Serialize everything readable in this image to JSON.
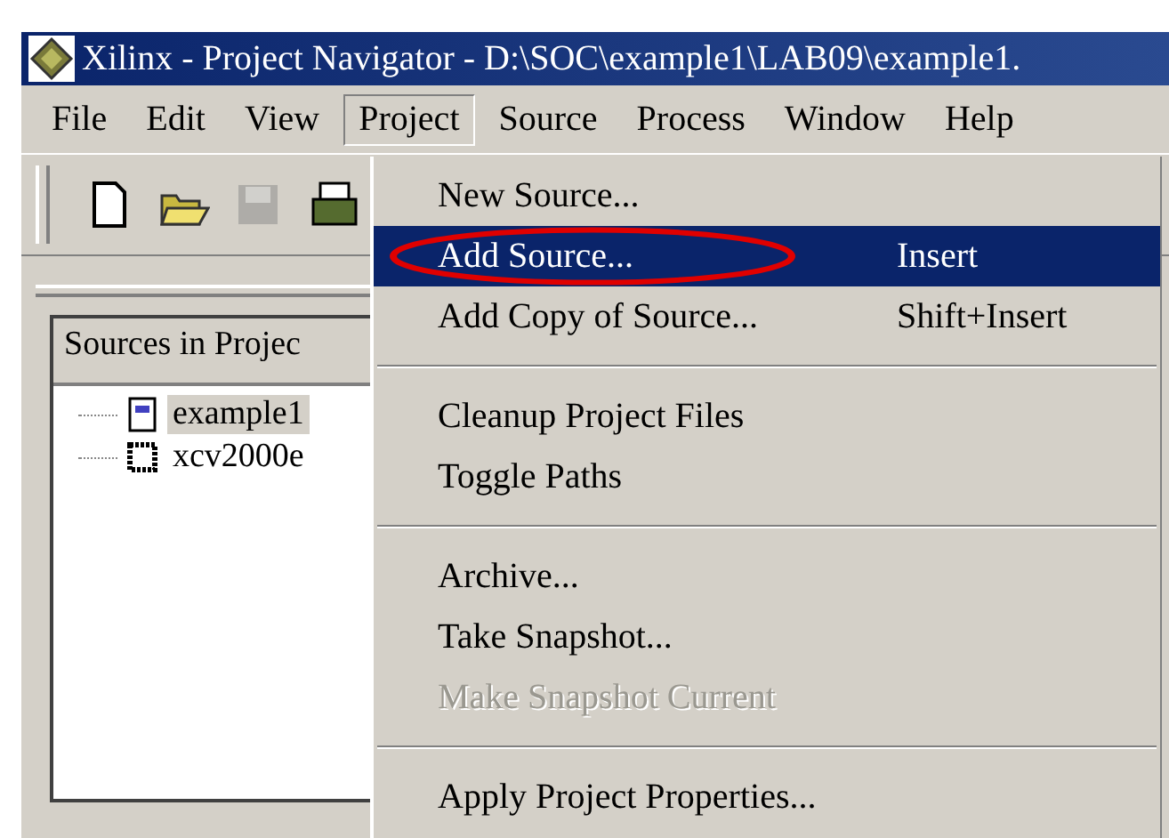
{
  "window": {
    "title": "Xilinx - Project Navigator - D:\\SOC\\example1\\LAB09\\example1."
  },
  "menu_bar": [
    {
      "label": "File",
      "selected": false
    },
    {
      "label": "Edit",
      "selected": false
    },
    {
      "label": "View",
      "selected": false
    },
    {
      "label": "Project",
      "selected": true
    },
    {
      "label": "Source",
      "selected": false
    },
    {
      "label": "Process",
      "selected": false
    },
    {
      "label": "Window",
      "selected": false
    },
    {
      "label": "Help",
      "selected": false
    }
  ],
  "toolbar": [
    {
      "kind": "new",
      "disabled": false
    },
    {
      "kind": "open",
      "disabled": false
    },
    {
      "kind": "save",
      "disabled": true
    },
    {
      "kind": "print",
      "disabled": false
    }
  ],
  "sources_panel": {
    "header": "Sources in Projec",
    "items": [
      {
        "label": "example1",
        "kind": "project",
        "selected": true
      },
      {
        "label": "xcv2000e",
        "kind": "chip",
        "selected": false
      }
    ]
  },
  "project_menu": [
    {
      "kind": "item",
      "label": "New Source...",
      "selected": false,
      "disabled": false,
      "circled": false
    },
    {
      "kind": "item",
      "label": "Add Source...",
      "shortcut": "Insert",
      "selected": true,
      "disabled": false,
      "circled": true
    },
    {
      "kind": "item",
      "label": "Add Copy of Source...",
      "shortcut": "Shift+Insert",
      "selected": false,
      "disabled": false,
      "circled": false
    },
    {
      "kind": "separator"
    },
    {
      "kind": "item",
      "label": "Cleanup Project Files",
      "selected": false,
      "disabled": false,
      "circled": false
    },
    {
      "kind": "item",
      "label": "Toggle Paths",
      "selected": false,
      "disabled": false,
      "circled": false
    },
    {
      "kind": "separator"
    },
    {
      "kind": "item",
      "label": "Archive...",
      "selected": false,
      "disabled": false,
      "circled": false
    },
    {
      "kind": "item",
      "label": "Take Snapshot...",
      "selected": false,
      "disabled": false,
      "circled": false
    },
    {
      "kind": "item",
      "label": "Make Snapshot Current",
      "selected": false,
      "disabled": true,
      "circled": false
    },
    {
      "kind": "separator"
    },
    {
      "kind": "item",
      "label": "Apply Project Properties...",
      "selected": false,
      "disabled": false,
      "circled": false
    }
  ]
}
